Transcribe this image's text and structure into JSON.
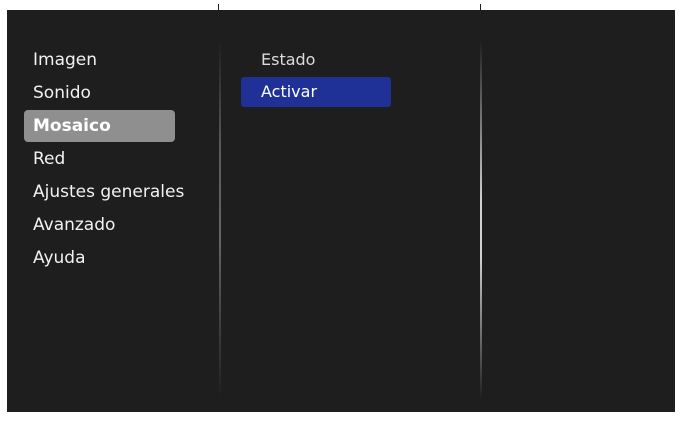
{
  "main_menu": {
    "items": [
      {
        "label": "Imagen",
        "selected": false
      },
      {
        "label": "Sonido",
        "selected": false
      },
      {
        "label": "Mosaico",
        "selected": true
      },
      {
        "label": "Red",
        "selected": false
      },
      {
        "label": "Ajustes generales",
        "selected": false
      },
      {
        "label": "Avanzado",
        "selected": false
      },
      {
        "label": "Ayuda",
        "selected": false
      }
    ]
  },
  "sub_menu": {
    "items": [
      {
        "label": "Estado",
        "selected": false
      },
      {
        "label": "Activar",
        "selected": true
      }
    ]
  },
  "colors": {
    "background": "#1e1e1e",
    "main_selected": "#8f8f8f",
    "sub_selected": "#1f3196",
    "text": "#f2f2f2"
  }
}
